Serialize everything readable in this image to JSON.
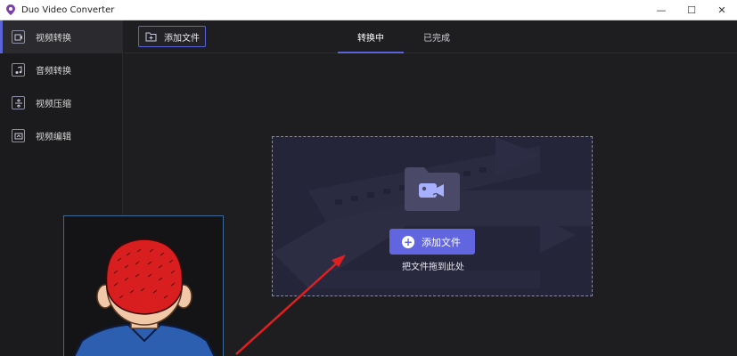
{
  "window": {
    "title": "Duo Video Converter",
    "controls": {
      "minimize": "—",
      "maximize": "☐",
      "close": "✕"
    }
  },
  "sidebar": {
    "items": [
      {
        "label": "视频转换",
        "icon": "video-convert-icon",
        "active": true
      },
      {
        "label": "音频转换",
        "icon": "audio-convert-icon",
        "active": false
      },
      {
        "label": "视频压缩",
        "icon": "compress-icon",
        "active": false
      },
      {
        "label": "视频编辑",
        "icon": "edit-icon",
        "active": false
      }
    ]
  },
  "toolbar": {
    "add_file_label": "添加文件",
    "tabs": [
      {
        "label": "转换中",
        "active": true
      },
      {
        "label": "已完成",
        "active": false
      }
    ]
  },
  "dropzone": {
    "button_label": "添加文件",
    "hint": "把文件拖到此处"
  },
  "colors": {
    "accent": "#5b63d8",
    "button": "#6166e0",
    "annotation_arrow": "#e02020"
  }
}
